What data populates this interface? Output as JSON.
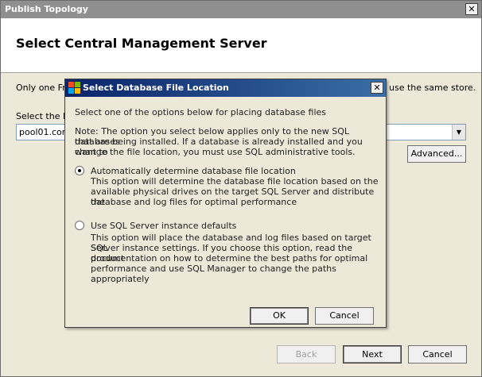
{
  "outer": {
    "title": "Publish Topology",
    "close_glyph": "✕",
    "page_title": "Select Central Management Server",
    "intro_left": "Only one Fro",
    "intro_right": "use the same store.",
    "select_label": "Select the Fr",
    "combo_value": "pool01.con",
    "advanced_label": "Advanced...",
    "back_label": "Back",
    "next_label": "Next",
    "cancel_label": "Cancel"
  },
  "dialog": {
    "title": "Select Database File Location",
    "close_glyph": "✕",
    "instruction": "Select one of the options below for placing database files",
    "note_line1": "Note: The option you select below applies only to the new SQL databases",
    "note_line2": "that are being installed. If a database is already installed and you want to",
    "note_line3": "change the file location, you must use SQL administrative tools.",
    "options": [
      {
        "label": "Automatically determine database file location",
        "desc_line1": "This option will determine the database file location based on the",
        "desc_line2": "available physical drives on the target SQL Server and distribute the",
        "desc_line3": "database and log files for optimal performance",
        "desc_line4": "",
        "selected": true
      },
      {
        "label": "Use SQL Server instance defaults",
        "desc_line1": "This option will place the database and log files based on target SQL",
        "desc_line2": "Server instance settings. If you choose this option, read the product",
        "desc_line3": "documentation on how to determine the best paths for optimal",
        "desc_line4": "performance and use SQL Manager to change the paths appropriately",
        "selected": false
      }
    ],
    "ok_label": "OK",
    "cancel_label": "Cancel"
  },
  "colors": {
    "dialog_title_start": "#0a246a",
    "dialog_title_end": "#3a6ea5",
    "outer_title_inactive": "#8f8f8f"
  }
}
